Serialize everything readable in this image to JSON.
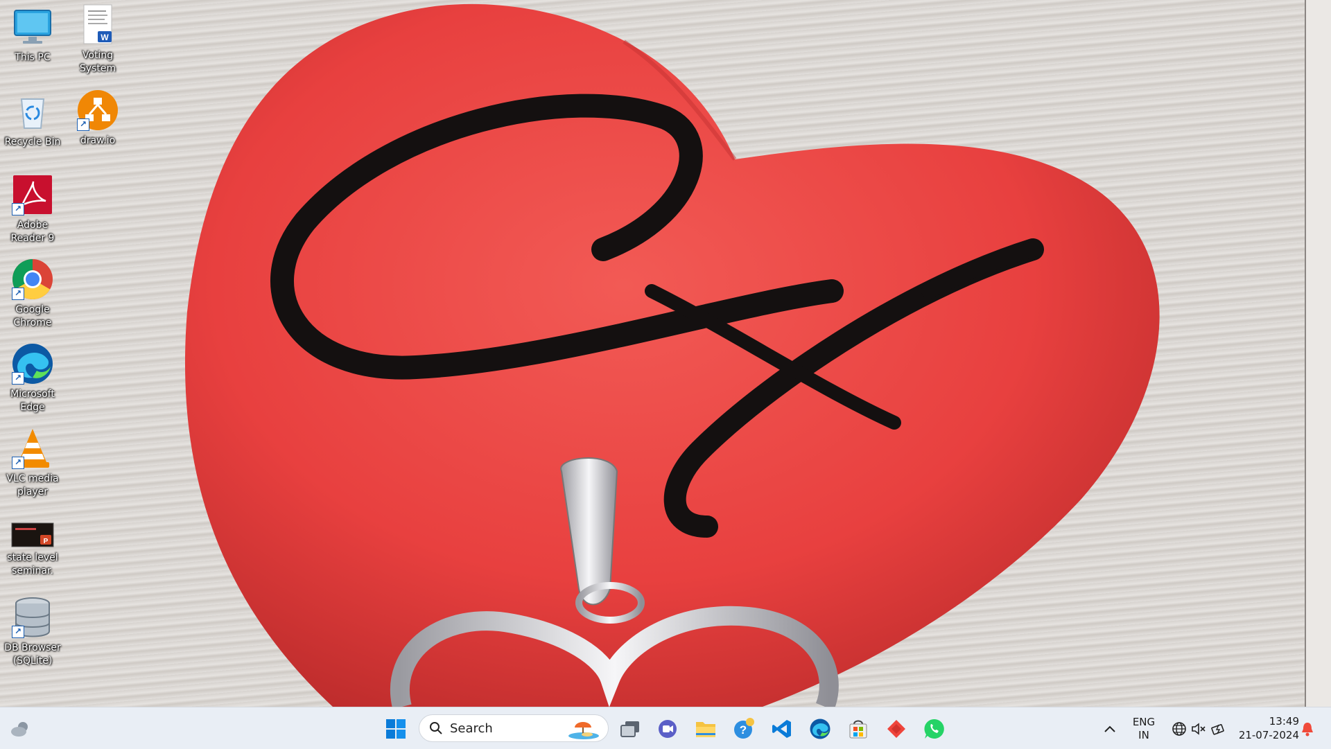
{
  "desktop": {
    "wallpaper": {
      "colors": {
        "heart": "#e8403f",
        "heart_dark": "#b92a2a",
        "ink": "#141010",
        "silver": "#e4e4e6"
      },
      "monogram_text": "CA"
    },
    "icons": [
      {
        "label": "This PC",
        "icon": "monitor-icon"
      },
      {
        "label": "Voting System",
        "icon": "word-document-icon"
      },
      {
        "label": "Recycle Bin",
        "icon": "recycle-bin-icon"
      },
      {
        "label": "draw.io",
        "icon": "drawio-icon"
      },
      {
        "label": "Adobe Reader 9",
        "icon": "adobe-reader-icon"
      },
      {
        "label": "Google Chrome",
        "icon": "chrome-icon"
      },
      {
        "label": "Microsoft Edge",
        "icon": "edge-icon"
      },
      {
        "label": "VLC media player",
        "icon": "vlc-icon"
      },
      {
        "label": "state level seminar.",
        "icon": "powerpoint-file-icon"
      },
      {
        "label": "DB Browser (SQLite)",
        "icon": "database-icon"
      }
    ]
  },
  "taskbar": {
    "search": {
      "placeholder": "Search"
    },
    "pinned": [
      "start-icon",
      "task-view-icon",
      "teams-chat-icon",
      "file-explorer-icon",
      "get-help-icon",
      "vscode-icon",
      "edge-icon",
      "store-icon",
      "anydesk-icon",
      "whatsapp-icon"
    ],
    "tray": {
      "language": "ENG",
      "region": "IN",
      "time": "13:49",
      "date": "21-07-2024"
    },
    "colors": {
      "background": "#e9eef5",
      "accent": "#0067c0"
    }
  }
}
